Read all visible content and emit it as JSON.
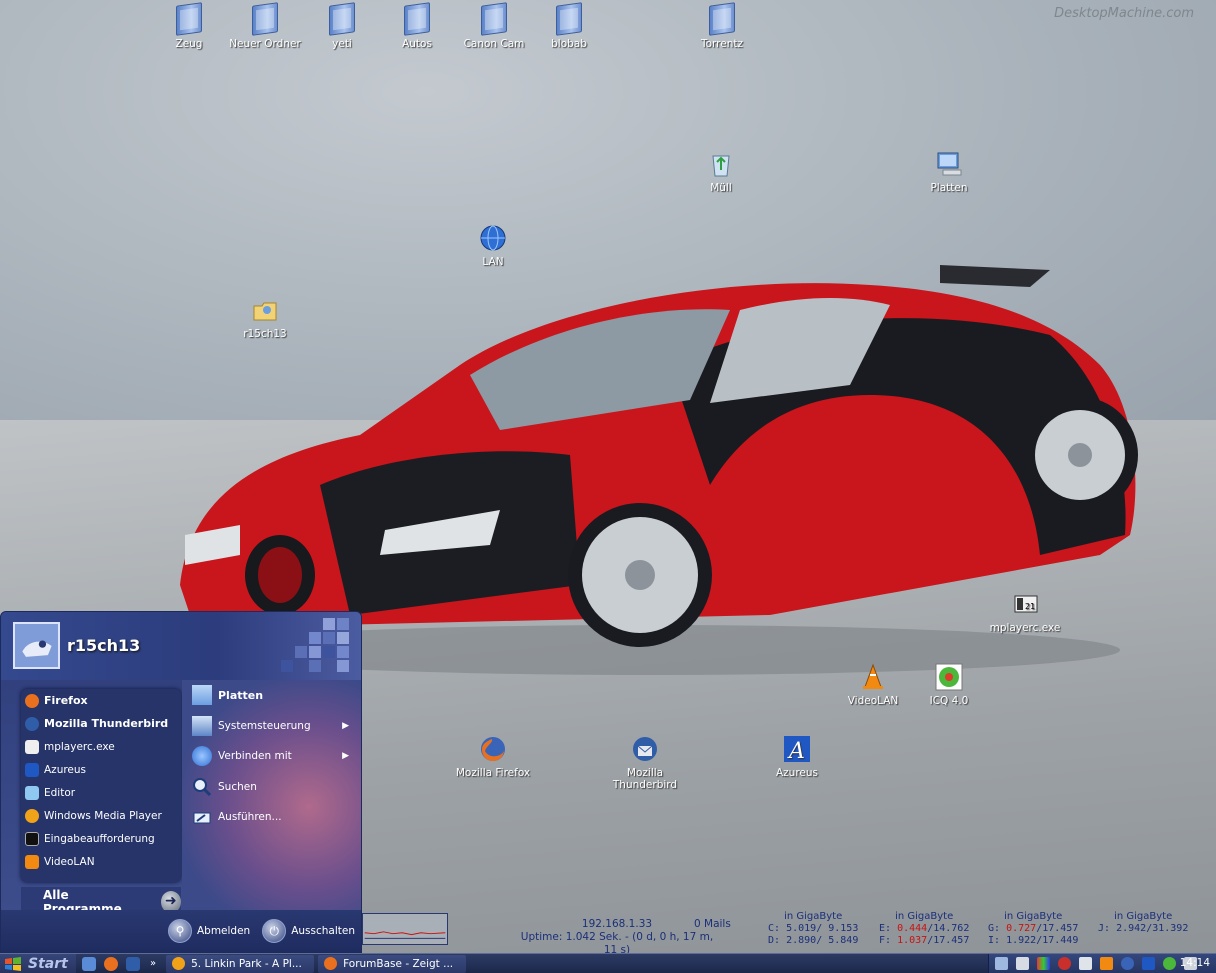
{
  "desktop": {
    "watermark": "DesktopMachine.com",
    "icons": [
      {
        "label": "Zeug",
        "icon": "folder-icon"
      },
      {
        "label": "Neuer Ordner",
        "icon": "folder-icon"
      },
      {
        "label": "yeti",
        "icon": "folder-icon"
      },
      {
        "label": "Autos",
        "icon": "folder-icon"
      },
      {
        "label": "Canon Cam",
        "icon": "folder-icon"
      },
      {
        "label": "blobab",
        "icon": "folder-icon"
      },
      {
        "label": "Torrentz",
        "icon": "folder-icon"
      },
      {
        "label": "Müll",
        "icon": "recycle-bin-icon"
      },
      {
        "label": "Platten",
        "icon": "my-computer-icon"
      },
      {
        "label": "LAN",
        "icon": "network-globe-icon"
      },
      {
        "label": "r15ch13",
        "icon": "user-folder-icon"
      },
      {
        "label": "mplayerc.exe",
        "icon": "media-player-classic-icon"
      },
      {
        "label": "VideoLAN",
        "icon": "vlc-cone-icon"
      },
      {
        "label": "ICQ 4.0",
        "icon": "icq-flower-icon"
      },
      {
        "label": "Mozilla Firefox",
        "icon": "firefox-icon"
      },
      {
        "label": "Mozilla Thunderbird",
        "icon": "thunderbird-icon"
      },
      {
        "label": "Azureus",
        "icon": "azureus-icon"
      }
    ]
  },
  "start_menu": {
    "user": "r15ch13",
    "pinned": [
      {
        "label": "Firefox",
        "icon": "firefox-icon"
      },
      {
        "label": "Mozilla Thunderbird",
        "icon": "thunderbird-icon"
      }
    ],
    "recent": [
      {
        "label": "mplayerc.exe",
        "icon": "media-player-classic-icon"
      },
      {
        "label": "Azureus",
        "icon": "azureus-icon"
      },
      {
        "label": "Editor",
        "icon": "notepad-icon"
      },
      {
        "label": "Windows Media Player",
        "icon": "windows-media-player-icon"
      },
      {
        "label": "Eingabeaufforderung",
        "icon": "command-prompt-icon"
      },
      {
        "label": "VideoLAN",
        "icon": "vlc-cone-icon"
      }
    ],
    "all_programs": "Alle Programme",
    "right": [
      {
        "label": "Platten",
        "icon": "my-computer-icon",
        "submenu": false
      },
      {
        "label": "Systemsteuerung",
        "icon": "control-panel-icon",
        "submenu": true
      },
      {
        "label": "Verbinden mit",
        "icon": "network-globe-icon",
        "submenu": true
      },
      {
        "label": "Suchen",
        "icon": "search-icon",
        "submenu": false
      },
      {
        "label": "Ausführen...",
        "icon": "run-icon",
        "submenu": false
      }
    ],
    "logoff": "Abmelden",
    "shutdown": "Ausschalten"
  },
  "monitor": {
    "ip": "192.168.1.33",
    "mails": "0 Mails",
    "uptime": "Uptime: 1.042 Sek. - (0 d, 0 h, 17 m, 11 s)",
    "unit": "in GigaByte",
    "drives": [
      {
        "rows": [
          {
            "letter": "C:",
            "used": "5.019",
            "total": "9.153",
            "warn": false
          },
          {
            "letter": "D:",
            "used": "2.890",
            "total": "5.849",
            "warn": false
          }
        ]
      },
      {
        "rows": [
          {
            "letter": "E:",
            "used": "0.444",
            "total": "14.762",
            "warn": true
          },
          {
            "letter": "F:",
            "used": "1.037",
            "total": "17.457",
            "warn": true
          }
        ]
      },
      {
        "rows": [
          {
            "letter": "G:",
            "used": "0.727",
            "total": "17.457",
            "warn": true
          },
          {
            "letter": "I:",
            "used": "1.922",
            "total": "17.449",
            "warn": false
          }
        ]
      },
      {
        "rows": [
          {
            "letter": "J:",
            "used": "2.942",
            "total": "31.392",
            "warn": false
          }
        ]
      }
    ]
  },
  "taskbar": {
    "start": "Start",
    "quick_launch": [
      "show-desktop-icon",
      "firefox-icon",
      "word-icon"
    ],
    "overflow": "»",
    "tasks": [
      {
        "label": "5. Linkin Park - A Pl...",
        "icon": "winamp-icon"
      },
      {
        "label": "ForumBase - Zeigt ...",
        "icon": "firefox-icon"
      }
    ],
    "tray_icons": [
      "network-icon",
      "eject-icon",
      "color-icon",
      "refresh-icon",
      "sync-icon",
      "rss-icon",
      "back-icon",
      "azureus-icon",
      "chat-icon",
      "volume-icon"
    ],
    "clock": "14:14"
  },
  "colors": {
    "startmenu": "#2e3d7a",
    "taskbar": "#233056",
    "monitor_text": "#1b2f7a",
    "warn": "#c81212"
  }
}
